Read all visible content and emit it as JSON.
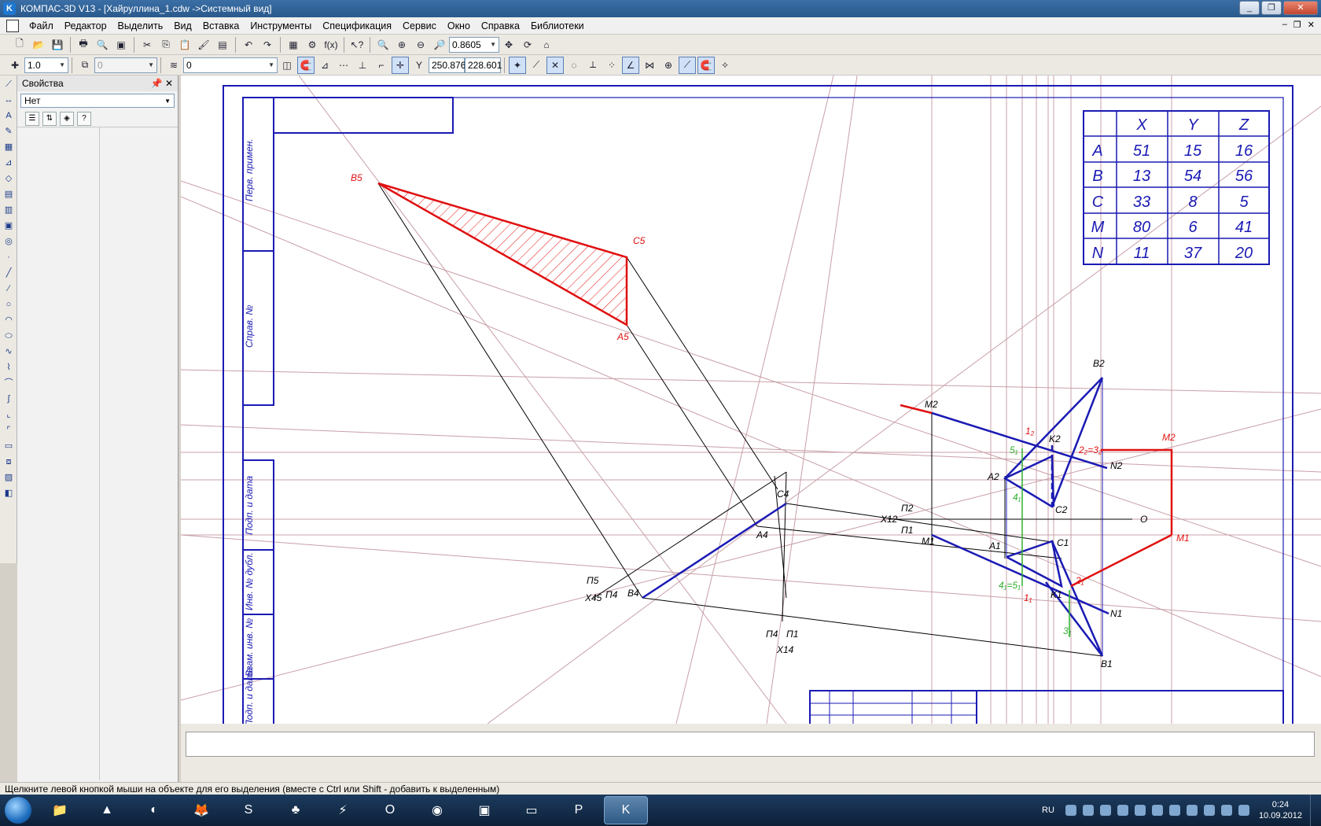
{
  "window": {
    "title": "КОМПАС-3D V13 - [Хайруллина_1.cdw ->Системный вид]",
    "controls": [
      "_",
      "❐",
      "✕"
    ]
  },
  "menu": [
    "Файл",
    "Редактор",
    "Выделить",
    "Вид",
    "Вставка",
    "Инструменты",
    "Спецификация",
    "Сервис",
    "Окно",
    "Справка",
    "Библиотеки"
  ],
  "mdi_controls": [
    "–",
    "❐",
    "✕"
  ],
  "toolbar1": {
    "zoom_value": "0.8605"
  },
  "toolbar2": {
    "scale_value": "1.0",
    "layer_value": "0",
    "style_value": "0",
    "coord_x": "250.876",
    "coord_y": "228.601"
  },
  "properties": {
    "title": "Свойства",
    "selection": "Нет"
  },
  "table": {
    "headers": [
      "",
      "X",
      "Y",
      "Z"
    ],
    "rows": [
      [
        "A",
        "51",
        "15",
        "16"
      ],
      [
        "B",
        "13",
        "54",
        "56"
      ],
      [
        "C",
        "33",
        "8",
        "5"
      ],
      [
        "M",
        "80",
        "6",
        "41"
      ],
      [
        "N",
        "11",
        "37",
        "20"
      ]
    ]
  },
  "stamp_labels": [
    "Перв. примен.",
    "Справ. №",
    "Подп. и дата",
    "Инв. № дубл.",
    "Взам. инв. №",
    "Подп. и дата"
  ],
  "point_labels": {
    "B5": "B5",
    "C5": "C5",
    "A5": "A5",
    "B2": "B2",
    "M2": "M2",
    "M2r": "M2",
    "N2": "N2",
    "A2": "A2",
    "C2": "C2",
    "K2": "K2",
    "l2": "1₂",
    "five1": "5₁",
    "four1": "4₁",
    "two3": "2₂=3₂",
    "A1": "A1",
    "C1": "C1",
    "M1": "M1",
    "M1r": "M1",
    "K1": "K1",
    "N1": "N1",
    "B1": "B1",
    "four5": "4₁=5₁",
    "one1": "1₁",
    "two1": "2₁",
    "three1": "3₁",
    "C4": "C4",
    "A4": "A4",
    "B4": "B4",
    "X12": "X12",
    "P2a": "П2",
    "P1a": "П1",
    "O": "O",
    "P5": "П5",
    "X45": "X45",
    "P4a": "П4",
    "P4b": "П4",
    "P1b": "П1",
    "X14": "X14"
  },
  "status_text": "Щелкните левой кнопкой мыши на объекте для его выделения (вместе с Ctrl или Shift - добавить к выделенным)",
  "tray": {
    "lang": "RU",
    "time": "0:24",
    "date": "10.09.2012"
  },
  "colors": {
    "blue": "#1a1ab4",
    "red": "#e01010",
    "aux": "#c8a0a8",
    "green": "#30b030"
  }
}
